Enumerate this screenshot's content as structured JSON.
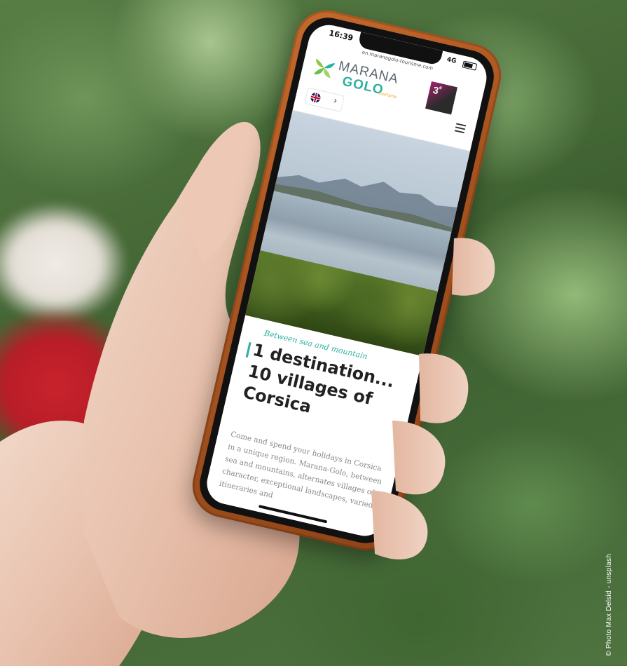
{
  "phone": {
    "status_time": "16:39",
    "status_network": "4G",
    "url": "en.maranagolo-tourisme.com",
    "logo": {
      "line1": "MARANA",
      "line2": "GOLO",
      "sub": "tourisme"
    },
    "badge": {
      "main": "3",
      "sup": "e"
    },
    "hero_tagline": "Between sea and mountain",
    "title_lines": [
      "1 destination...",
      "10 villages of",
      "Corsica"
    ],
    "body_text": "Come and spend your holidays in Corsica in a unique region. Marana-Golo, between sea and mountains, alternates villages of character, exceptional landscapes, varied itineraries and"
  },
  "credit": "© Photo Max Delsid - unsplash",
  "colors": {
    "accent": "#2db09d",
    "case": "#a85420",
    "badge": "#a0226b"
  }
}
